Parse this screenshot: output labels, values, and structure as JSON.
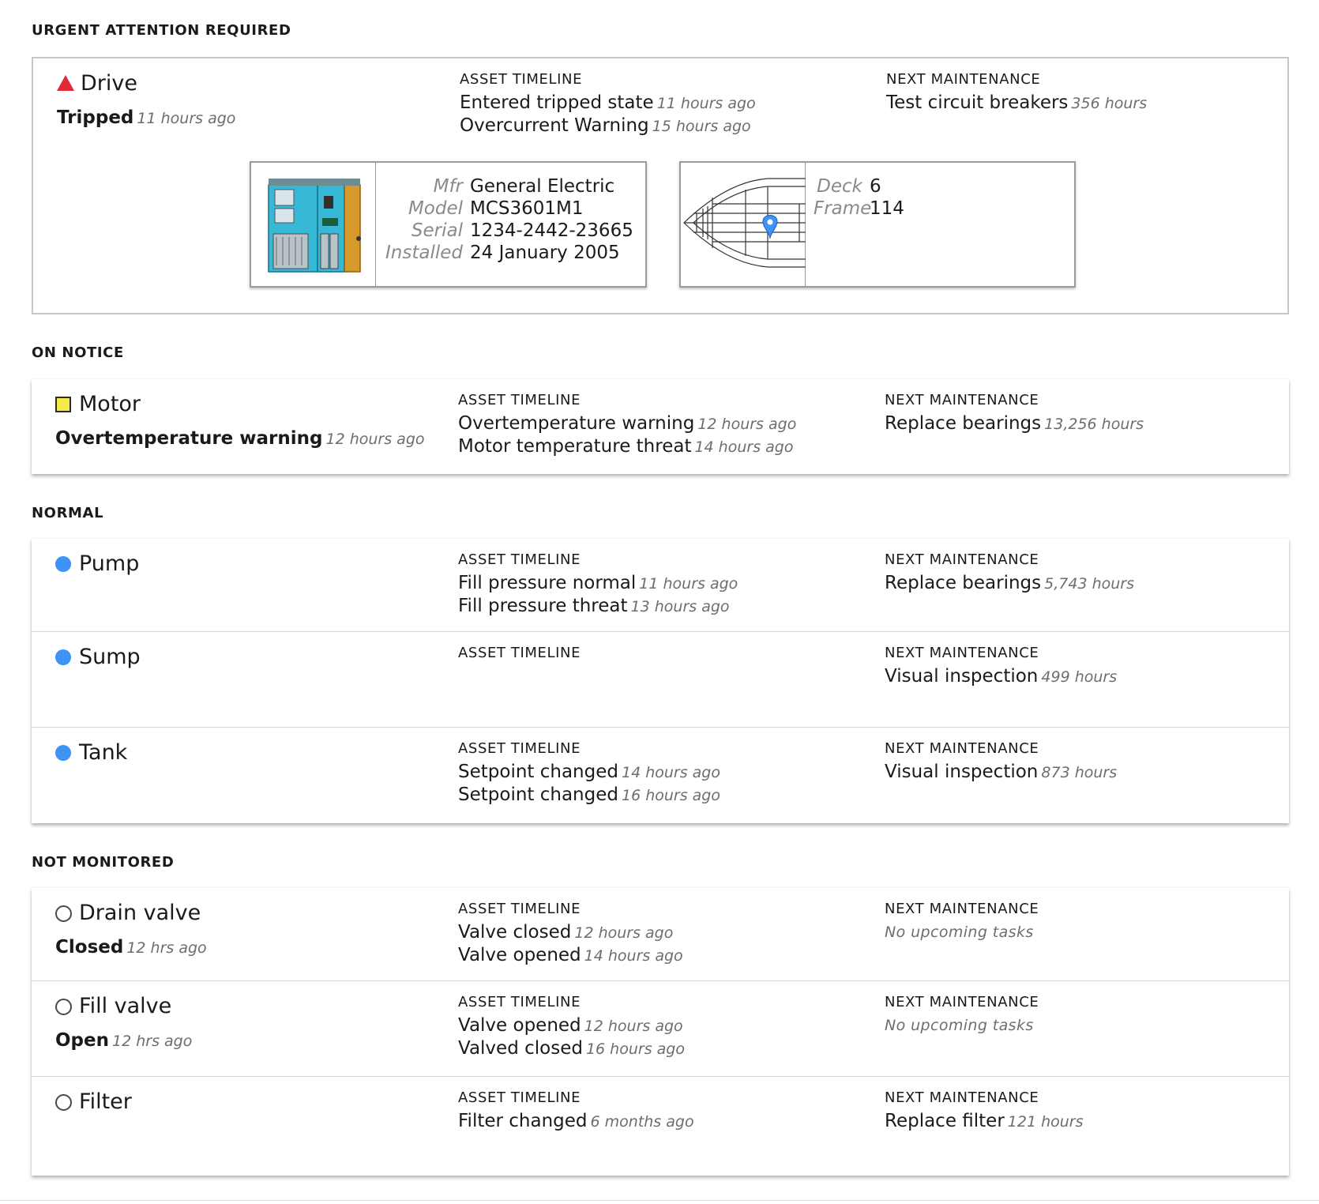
{
  "labels": {
    "timeline": "ASSET TIMELINE",
    "maintenance": "NEXT MAINTENANCE"
  },
  "sections": {
    "urgent": "URGENT ATTENTION REQUIRED",
    "notice": "ON NOTICE",
    "normal": "NORMAL",
    "not_monitored": "NOT MONITORED"
  },
  "status_colors": {
    "urgent": "#e02a36",
    "notice": "#f1ec48",
    "normal": "#3f93f5",
    "not_monitored": "#4a4a4a"
  },
  "drive": {
    "name": "Drive",
    "icon": "warning-triangle-icon",
    "state": "Tripped",
    "state_ago": "11 hours ago",
    "timeline": [
      {
        "event": "Entered tripped state",
        "ago": "11 hours ago"
      },
      {
        "event": "Overcurrent Warning",
        "ago": "15 hours ago"
      }
    ],
    "maintenance": {
      "task": "Test circuit breakers",
      "hours": "356 hours"
    },
    "details": {
      "mfr_label": "Mfr",
      "mfr": "General Electric",
      "model_label": "Model",
      "model": "MCS3601M1",
      "serial_label": "Serial",
      "serial": "1234-2442-23665",
      "installed_label": "Installed",
      "installed": "24 January 2005"
    },
    "location": {
      "deck_label": "Deck",
      "deck": "6",
      "frame_label": "Frame",
      "frame": "114"
    }
  },
  "motor": {
    "name": "Motor",
    "icon": "warning-square-icon",
    "state": "Overtemperature warning",
    "state_ago": "12 hours ago",
    "timeline": [
      {
        "event": "Overtemperature warning",
        "ago": "12 hours ago"
      },
      {
        "event": "Motor temperature threat",
        "ago": "14 hours ago"
      }
    ],
    "maintenance": {
      "task": "Replace bearings",
      "hours": "13,256 hours"
    }
  },
  "pump": {
    "name": "Pump",
    "icon": "normal-dot-icon",
    "timeline": [
      {
        "event": "Fill pressure normal",
        "ago": "11 hours ago"
      },
      {
        "event": "Fill pressure threat",
        "ago": "13 hours ago"
      }
    ],
    "maintenance": {
      "task": "Replace bearings",
      "hours": "5,743 hours"
    }
  },
  "sump": {
    "name": "Sump",
    "icon": "normal-dot-icon",
    "maintenance": {
      "task": "Visual inspection",
      "hours": "499 hours"
    }
  },
  "tank": {
    "name": "Tank",
    "icon": "normal-dot-icon",
    "timeline": [
      {
        "event": "Setpoint changed",
        "ago": "14 hours ago"
      },
      {
        "event": "Setpoint changed",
        "ago": "16 hours ago"
      }
    ],
    "maintenance": {
      "task": "Visual inspection",
      "hours": "873 hours"
    }
  },
  "drain_valve": {
    "name": "Drain valve",
    "icon": "unmonitored-circle-icon",
    "state": "Closed",
    "state_ago": "12 hrs ago",
    "timeline": [
      {
        "event": "Valve closed",
        "ago": "12 hours ago"
      },
      {
        "event": "Valve opened",
        "ago": "14 hours ago"
      }
    ],
    "maintenance": {
      "none": "No upcoming tasks"
    }
  },
  "fill_valve": {
    "name": "Fill valve",
    "icon": "unmonitored-circle-icon",
    "state": "Open",
    "state_ago": "12 hrs ago",
    "timeline": [
      {
        "event": "Valve opened",
        "ago": "12 hours ago"
      },
      {
        "event": "Valved closed",
        "ago": "16 hours ago"
      }
    ],
    "maintenance": {
      "none": "No upcoming tasks"
    }
  },
  "filter": {
    "name": "Filter",
    "icon": "unmonitored-circle-icon",
    "timeline": [
      {
        "event": "Filter changed",
        "ago": "6 months ago"
      }
    ],
    "maintenance": {
      "task": "Replace filter",
      "hours": "121 hours"
    }
  }
}
